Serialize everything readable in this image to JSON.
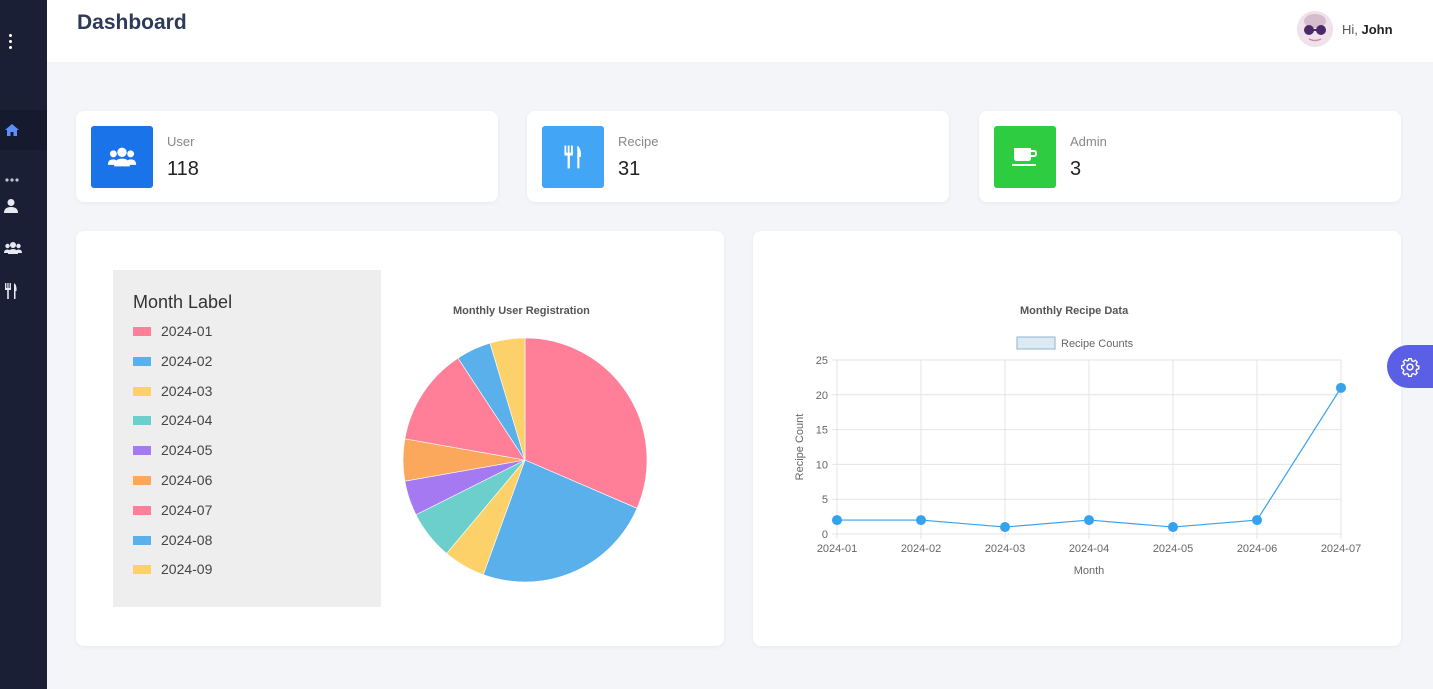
{
  "header": {
    "title": "Dashboard",
    "greeting": "Hi,",
    "user_name": "John"
  },
  "sidebar": {
    "icons": [
      "menu-dots-icon",
      "home-icon",
      "more-dots-icon",
      "user-icon",
      "users-icon",
      "utensils-icon"
    ]
  },
  "stats": [
    {
      "label": "User",
      "value": "118",
      "icon": "users-icon",
      "color": "#1a73e8"
    },
    {
      "label": "Recipe",
      "value": "31",
      "icon": "utensils-icon",
      "color": "#42a5f5"
    },
    {
      "label": "Admin",
      "value": "3",
      "icon": "coffee-icon",
      "color": "#2ecc40"
    }
  ],
  "legend": {
    "title": "Month Label",
    "items": [
      {
        "label": "2024-01",
        "color": "#ff7f98"
      },
      {
        "label": "2024-02",
        "color": "#5ab0ea"
      },
      {
        "label": "2024-03",
        "color": "#fdd16a"
      },
      {
        "label": "2024-04",
        "color": "#6ccfcb"
      },
      {
        "label": "2024-05",
        "color": "#a479f2"
      },
      {
        "label": "2024-06",
        "color": "#fca85c"
      },
      {
        "label": "2024-07",
        "color": "#ff7f98"
      },
      {
        "label": "2024-08",
        "color": "#5ab0ea"
      },
      {
        "label": "2024-09",
        "color": "#fdd16a"
      }
    ]
  },
  "chart_data": [
    {
      "type": "pie",
      "title": "Monthly User Registration",
      "categories": [
        "2024-01",
        "2024-02",
        "2024-03",
        "2024-04",
        "2024-05",
        "2024-06",
        "2024-07",
        "2024-08",
        "2024-09"
      ],
      "values": [
        34,
        26,
        6,
        7,
        5,
        6,
        14,
        5,
        5
      ],
      "colors": [
        "#ff7f98",
        "#5ab0ea",
        "#fdd16a",
        "#6ccfcb",
        "#a479f2",
        "#fca85c",
        "#ff7f98",
        "#5ab0ea",
        "#fdd16a"
      ]
    },
    {
      "type": "line",
      "title": "Monthly Recipe Data",
      "x": [
        "2024-01",
        "2024-02",
        "2024-03",
        "2024-04",
        "2024-05",
        "2024-06",
        "2024-07"
      ],
      "series": [
        {
          "name": "Recipe Counts",
          "values": [
            2,
            2,
            1,
            2,
            1,
            2,
            21
          ],
          "color": "#36a2eb"
        }
      ],
      "xlabel": "Month",
      "ylabel": "Recipe Count",
      "ylim": [
        0,
        25
      ],
      "yticks": [
        0,
        5,
        10,
        15,
        20,
        25
      ],
      "grid": true,
      "legend": "top"
    }
  ]
}
